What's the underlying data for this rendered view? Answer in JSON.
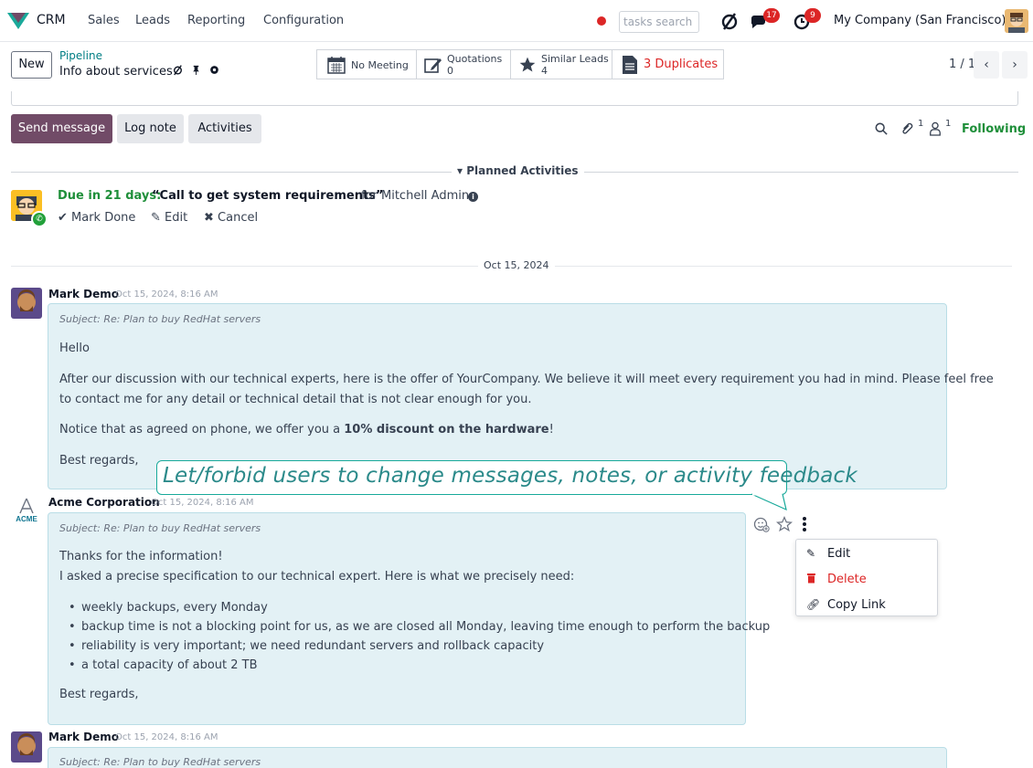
{
  "navbar": {
    "app": "CRM",
    "menus": [
      "Sales",
      "Leads",
      "Reporting",
      "Configuration"
    ],
    "search_placeholder": "tasks search",
    "messages_count": "17",
    "activities_count": "9",
    "company": "My Company (San Francisco)"
  },
  "control": {
    "new_label": "New",
    "breadcrumb_parent": "Pipeline",
    "breadcrumb_current": "Info about services",
    "smart_buttons": {
      "meeting": "No Meeting",
      "quotations_label": "Quotations",
      "quotations_value": "0",
      "similar_label": "Similar Leads",
      "similar_value": "4",
      "duplicates": "3 Duplicates"
    },
    "pager": "1 / 1"
  },
  "chatter": {
    "send_label": "Send message",
    "log_label": "Log note",
    "activities_label": "Activities",
    "attachments_count": "1",
    "followers_count": "1",
    "following_label": "Following",
    "planned_title": "▾ Planned Activities",
    "activity": {
      "due": "Due in 21 days:",
      "summary": "“Call to get system requirements”",
      "for_user": "for Mitchell Admin",
      "mark_done": "Mark Done",
      "edit": "Edit",
      "cancel": "Cancel"
    },
    "date_separator": "Oct 15, 2024",
    "messages": [
      {
        "author": "Mark Demo",
        "date": "Oct 15, 2024, 8:16 AM",
        "subject": "Subject: Re: Plan to buy RedHat servers",
        "p1": "Hello",
        "p2a": "After our discussion with our technical experts, here is the offer of YourCompany. We believe it will meet every requirement you had in mind. Please feel free",
        "p2b": "to contact me for any detail or technical detail that is not clear enough for you.",
        "p3a": "Notice that as agreed on phone, we offer you a ",
        "p3b": "10% discount on the hardware",
        "p3c": "!",
        "p4": "Best regards,"
      },
      {
        "author": "Acme Corporation",
        "date": "Oct 15, 2024, 8:16 AM",
        "logo_text": "ACME",
        "subject": "Subject: Re: Plan to buy RedHat servers",
        "p1a": "Thanks for the information!",
        "p1b": "I asked a precise specification to our technical expert. Here is what we precisely need:",
        "bullets": [
          "weekly backups, every Monday",
          "backup time is not a blocking point for us, as we are closed all Monday, leaving time enough to perform the backup",
          "reliability is very important; we need redundant servers and rollback capacity",
          "a total capacity of about 2 TB"
        ],
        "p2": "Best regards,"
      },
      {
        "author": "Mark Demo",
        "date": "Oct 15, 2024, 8:16 AM",
        "subject": "Subject: Re: Plan to buy RedHat servers"
      }
    ],
    "menu": {
      "edit": "Edit",
      "delete": "Delete",
      "copy_link": "Copy Link"
    }
  },
  "callout_text": "Let/forbid users to change messages, notes, or activity feedback",
  "colors": {
    "brand": "#714b67",
    "teal": "#017e84",
    "success": "#1f8f3a",
    "danger": "#dc2626",
    "bubble": "#e3f1f5"
  }
}
